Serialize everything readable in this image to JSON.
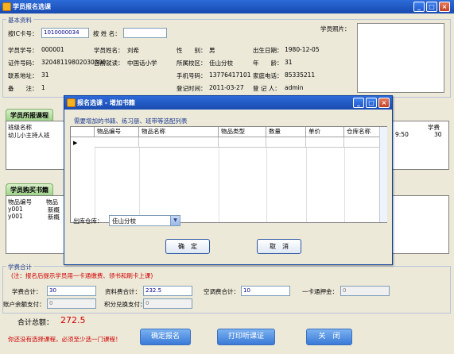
{
  "window": {
    "title": "学员报名选课"
  },
  "basic_info": {
    "section_label": "基本资料",
    "ic_label": "按IC卡号：",
    "ic_value": "1010000034",
    "name_search_label": "按 姓 名：",
    "photo_label": "学员照片：",
    "rows": [
      [
        {
          "l": "学员学号：",
          "v": "000001"
        },
        {
          "l": "学员姓名：",
          "v": "刘希"
        },
        {
          "l": "性　　别：",
          "v": "男"
        },
        {
          "l": "出生日期：",
          "v": "1980-12-05"
        }
      ],
      [
        {
          "l": "证件号码：",
          "v": "32048119802030300"
        },
        {
          "l": "目前就读：",
          "v": "中国话小学"
        },
        {
          "l": "所属校区：",
          "v": "佳山分校"
        },
        {
          "l": "年　　龄：",
          "v": "31"
        }
      ],
      [
        {
          "l": "联系地址：",
          "v": "31"
        },
        {
          "l": "",
          "v": ""
        },
        {
          "l": "手机号码：",
          "v": "13776417101"
        },
        {
          "l": "家庭电话：",
          "v": "85335211"
        }
      ],
      [
        {
          "l": "备　　注：",
          "v": "1"
        },
        {
          "l": "",
          "v": ""
        },
        {
          "l": "登记时间：",
          "v": "2011-03-27"
        },
        {
          "l": "登 记 人：",
          "v": "admin"
        }
      ]
    ]
  },
  "courses": {
    "tab_label": "学员所报课程",
    "headers": [
      "班级名称"
    ],
    "rows": [
      [
        "幼儿小主持人班"
      ]
    ],
    "right_header": "学费",
    "right_values": [
      "9:50",
      "30"
    ]
  },
  "books": {
    "tab_label": "学员购买书籍",
    "headers": [
      "物品编号",
      "物品"
    ],
    "rows": [
      [
        "y001",
        "新概"
      ],
      [
        "y001",
        "新概"
      ]
    ]
  },
  "dialog": {
    "title": "报名选课 - 增加书籍",
    "caption": "需要增加的书籍、练习册、班带等选配列表",
    "columns": [
      "物品编号",
      "物品名称",
      "物品类型",
      "数量",
      "单价",
      "仓库名称"
    ],
    "warehouse_label": "出库仓库：",
    "warehouse_value": "佳山分校",
    "ok_label": "确　定",
    "cancel_label": "取　消"
  },
  "fees": {
    "section_label": "学费合计",
    "notice": "(注：报名后提示学员用一卡通缴费、领书和刷卡上课)",
    "items": [
      {
        "l": "学费合计：",
        "v": "30"
      },
      {
        "l": "资料费合计：",
        "v": "232.5"
      },
      {
        "l": "空调费合计：",
        "v": "10"
      },
      {
        "l": "一卡通押金：",
        "v": "0"
      }
    ],
    "balance_label": "账户余额支付：",
    "balance_value": "0",
    "points_label": "积分兑换支付：",
    "points_value": "0",
    "total_label": "合计总额：",
    "total_value": "272.5"
  },
  "footer": {
    "warning": "你还没有选择课程，必须至少选一门课程！",
    "confirm_label": "确定报名",
    "print_label": "打印听课证",
    "close_label": "关　闭"
  }
}
